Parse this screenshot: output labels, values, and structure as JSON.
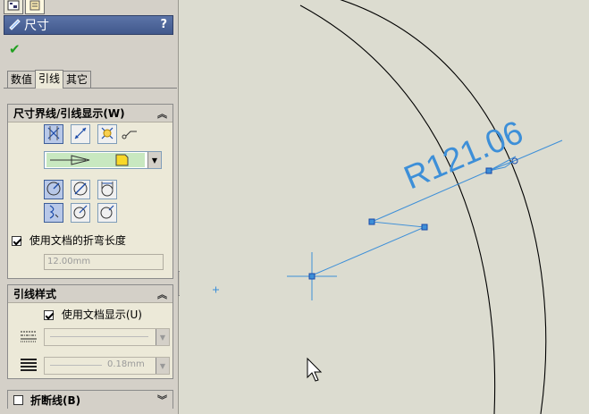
{
  "panel": {
    "top_tabs": [
      {
        "icon": "feature-manager-icon"
      },
      {
        "icon": "property-manager-icon"
      }
    ],
    "title": "尺寸",
    "help": "?",
    "subtabs": [
      "数值",
      "引线",
      "其它"
    ],
    "active_subtab": "引线",
    "group_witness": {
      "title": "尺寸界线/引线显示(W)",
      "use_doc_bend_label": "使用文档的折弯长度",
      "use_doc_bend_checked": true,
      "bend_length_value": "12.00mm"
    },
    "group_leader_style": {
      "title": "引线样式",
      "use_doc_display_label": "使用文档显示(U)",
      "use_doc_display_checked": true,
      "line_weight_value": "0.18mm"
    },
    "group_break": {
      "title": "折断线(B)",
      "checked": false
    }
  },
  "canvas": {
    "dimension_text": "R121.06",
    "colors": {
      "background": "#dcdcd0",
      "sketch_line": "#000000",
      "dimension": "#3d8fd8",
      "handle": "#3d8fd8"
    }
  }
}
